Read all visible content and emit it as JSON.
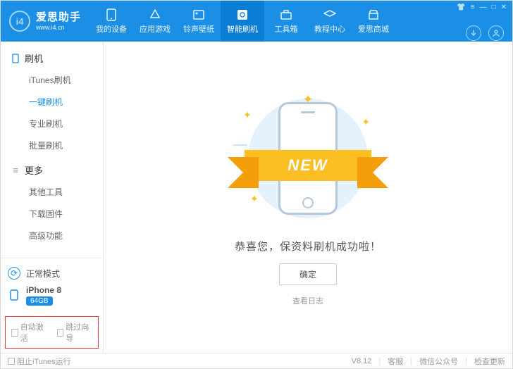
{
  "brand": {
    "title": "爱思助手",
    "subtitle": "www.i4.cn",
    "logo": "i4"
  },
  "top_nav": [
    {
      "label": "我的设备"
    },
    {
      "label": "应用游戏"
    },
    {
      "label": "铃声壁纸"
    },
    {
      "label": "智能刷机",
      "active": true
    },
    {
      "label": "工具箱"
    },
    {
      "label": "教程中心"
    },
    {
      "label": "爱思商城"
    }
  ],
  "sidebar": {
    "sections": [
      {
        "title": "刷机",
        "items": [
          {
            "label": "iTunes刷机"
          },
          {
            "label": "一键刷机",
            "active": true
          },
          {
            "label": "专业刷机"
          },
          {
            "label": "批量刷机"
          }
        ]
      },
      {
        "title": "更多",
        "items": [
          {
            "label": "其他工具"
          },
          {
            "label": "下载固件"
          },
          {
            "label": "高级功能"
          }
        ]
      }
    ],
    "mode_label": "正常模式",
    "device_name": "iPhone 8",
    "device_storage": "64GB",
    "auto_activate": "自动激活",
    "skip_wizard": "跳过向导"
  },
  "main": {
    "ribbon": "NEW",
    "success": "恭喜您，保资料刷机成功啦！",
    "ok": "确定",
    "log": "查看日志"
  },
  "status": {
    "block_itunes": "阻止iTunes运行",
    "version": "V8.12",
    "kefu": "客服",
    "wechat": "微信公众号",
    "update": "检查更新"
  }
}
